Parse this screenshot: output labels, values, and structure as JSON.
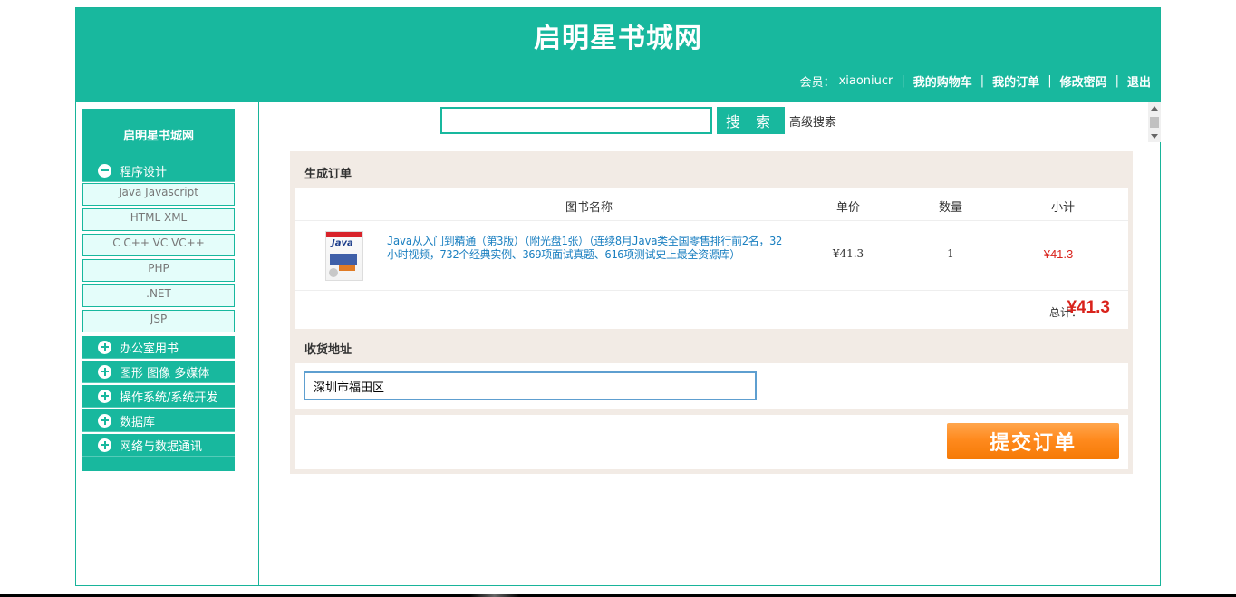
{
  "header": {
    "title": "启明星书城网",
    "member_label": "会员：",
    "username": "xiaoniucr",
    "separator": "|",
    "links": [
      "我的购物车",
      "我的订单",
      "修改密码",
      "退出"
    ]
  },
  "sidebar": {
    "title": "启明星书城网",
    "categories": [
      {
        "label": "程序设计",
        "expanded": true,
        "icon": "minus-circle-icon",
        "items": [
          "Java Javascript",
          "HTML XML",
          "C C++ VC VC++",
          "PHP",
          ".NET",
          "JSP"
        ]
      },
      {
        "label": "办公室用书",
        "expanded": false,
        "icon": "plus-circle-icon"
      },
      {
        "label": "图形 图像 多媒体",
        "expanded": false,
        "icon": "plus-circle-icon"
      },
      {
        "label": "操作系统/系统开发",
        "expanded": false,
        "icon": "plus-circle-icon"
      },
      {
        "label": "数据库",
        "expanded": false,
        "icon": "plus-circle-icon"
      },
      {
        "label": "网络与数据通讯",
        "expanded": false,
        "icon": "plus-circle-icon"
      }
    ]
  },
  "search": {
    "value": "",
    "button_label": "搜 索",
    "advanced_label": "高级搜索"
  },
  "order": {
    "section_title": "生成订单",
    "columns": [
      "图书名称",
      "单价",
      "数量",
      "小计"
    ],
    "items": [
      {
        "cover_text": "Java",
        "name": "Java从入门到精通（第3版）（附光盘1张）（连续8月Java类全国零售排行前2名，32小时视频，732个经典实例、369项面试真题、616项测试史上最全资源库）",
        "price": "¥41.3",
        "quantity": "1",
        "subtotal": "¥41.3"
      }
    ],
    "total_label": "总计：",
    "total_value": "¥41.3"
  },
  "address": {
    "section_title": "收货地址",
    "value": "深圳市福田区"
  },
  "submit": {
    "label": "提交订单"
  },
  "colors": {
    "brand": "#18b89e",
    "price_red": "#d9231c",
    "submit_orange": "#ff8a1e",
    "panel_bg": "#f2ebe5"
  }
}
